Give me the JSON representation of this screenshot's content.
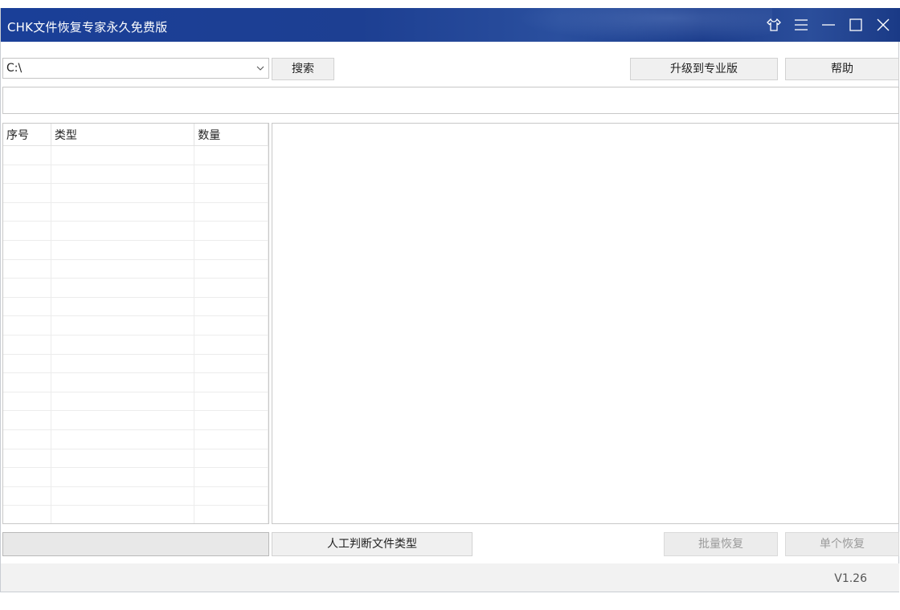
{
  "window": {
    "title": "CHK文件恢复专家永久免费版",
    "icons": [
      "skin-icon",
      "menu-icon",
      "minimize-icon",
      "maximize-icon",
      "close-icon"
    ]
  },
  "toolbar": {
    "drive_value": "C:\\",
    "search_label": "搜索",
    "upgrade_label": "升级到专业版",
    "help_label": "帮助"
  },
  "status_text": "",
  "list": {
    "columns": [
      "序号",
      "类型",
      "数量"
    ],
    "rows": []
  },
  "actions": {
    "identify_label": "人工判断文件类型",
    "batch_recover_label": "批量恢复",
    "single_recover_label": "单个恢复"
  },
  "footer": {
    "version": "V1.26"
  },
  "colors": {
    "titlebar": "#1d3f92",
    "button_bg": "#f0f0f0",
    "disabled_text": "#9a9a9a"
  }
}
